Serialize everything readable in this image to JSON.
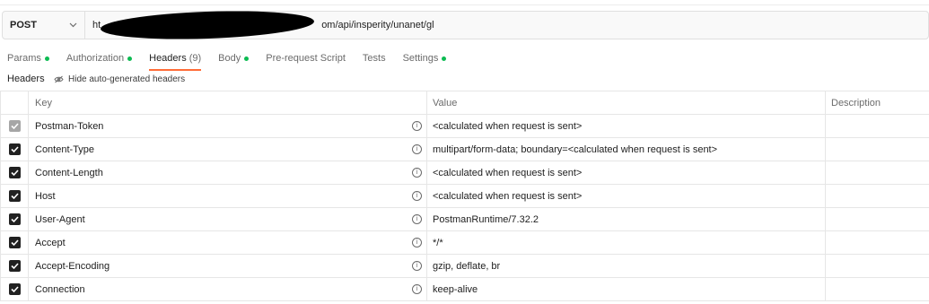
{
  "request": {
    "method": "POST",
    "url_prefix": "ht",
    "url_suffix": "om/api/insperity/unanet/gl"
  },
  "tabs": [
    {
      "label": "Params",
      "dot": true
    },
    {
      "label": "Authorization",
      "dot": true
    },
    {
      "label": "Headers",
      "count": "(9)",
      "active": true
    },
    {
      "label": "Body",
      "dot": true
    },
    {
      "label": "Pre-request Script"
    },
    {
      "label": "Tests"
    },
    {
      "label": "Settings",
      "dot": true
    }
  ],
  "headers_section": {
    "label": "Headers",
    "hide_button": "Hide auto-generated headers"
  },
  "table": {
    "columns": {
      "key": "Key",
      "value": "Value",
      "description": "Description"
    },
    "rows": [
      {
        "key": "Postman-Token",
        "value": "<calculated when request is sent>",
        "checked": true,
        "disabled": true
      },
      {
        "key": "Content-Type",
        "value": "multipart/form-data; boundary=<calculated when request is sent>",
        "checked": true
      },
      {
        "key": "Content-Length",
        "value": "<calculated when request is sent>",
        "checked": true
      },
      {
        "key": "Host",
        "value": "<calculated when request is sent>",
        "checked": true
      },
      {
        "key": "User-Agent",
        "value": "PostmanRuntime/7.32.2",
        "checked": true
      },
      {
        "key": "Accept",
        "value": "*/*",
        "checked": true
      },
      {
        "key": "Accept-Encoding",
        "value": "gzip, deflate, br",
        "checked": true
      },
      {
        "key": "Connection",
        "value": "keep-alive",
        "checked": true
      }
    ]
  },
  "info_icon": "i",
  "colors": {
    "accent": "#ff6c37",
    "dot": "#0cbb52"
  }
}
